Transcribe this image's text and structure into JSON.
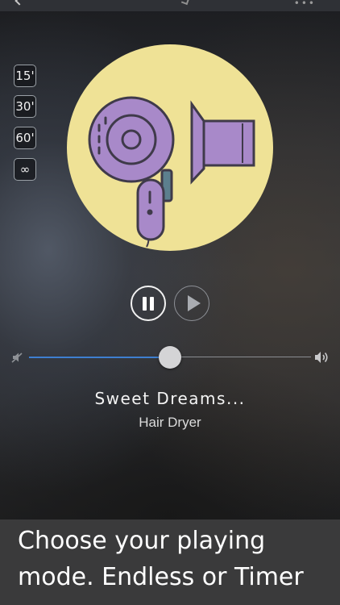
{
  "timer_options": {
    "t15": "15'",
    "t30": "30'",
    "t60": "60'",
    "endless": "∞"
  },
  "player": {
    "artwork_icon": "hair-dryer-icon",
    "pause_icon": "pause-icon",
    "play_icon": "play-icon",
    "volume": {
      "level": 0.5,
      "min_icon": "volume-mute-icon",
      "max_icon": "volume-high-icon"
    },
    "title": "Sweet Dreams...",
    "subtitle": "Hair Dryer"
  },
  "caption": {
    "text": "Choose your playing mode. Endless or Timer"
  },
  "colors": {
    "artwork_background": "#efe296",
    "dryer_body": "#a889c9",
    "dryer_outline": "#3f3a4a",
    "slider_fill": "#3e7fd0"
  }
}
